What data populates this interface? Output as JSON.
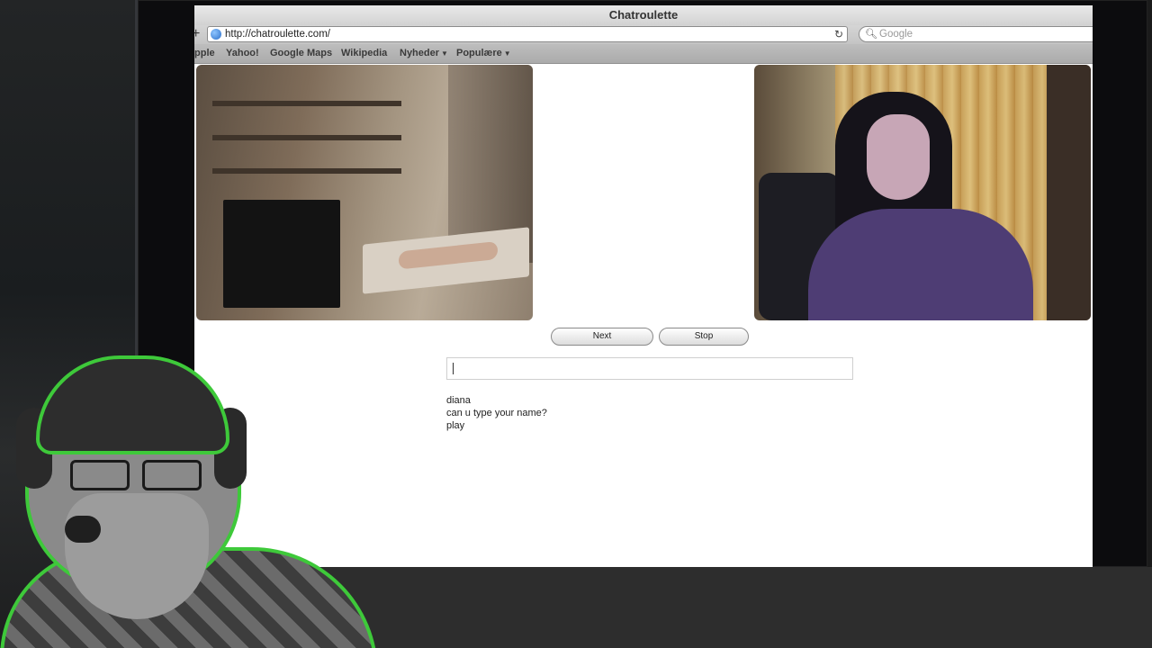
{
  "window": {
    "title": "Chatroulette"
  },
  "toolbar": {
    "new_tab_glyph": "+",
    "url": "http://chatroulette.com/",
    "search_placeholder": "Google"
  },
  "bookmarks": {
    "items": [
      {
        "label": "pple"
      },
      {
        "label": "Yahoo!"
      },
      {
        "label": "Google Maps"
      },
      {
        "label": "Wikipedia"
      },
      {
        "label": "Nyheder",
        "has_menu": true
      },
      {
        "label": "Populære",
        "has_menu": true
      }
    ]
  },
  "controls": {
    "next_label": "Next",
    "stop_label": "Stop"
  },
  "chat": {
    "input_value": "",
    "messages": [
      "diana",
      "can u type your name?",
      "play"
    ]
  },
  "icons": {
    "favicon": "globe-icon",
    "reload": "reload-icon",
    "search": "search-icon",
    "menu_caret": "chevron-down-icon"
  },
  "colors": {
    "overlay_outline": "#3ec93a"
  }
}
